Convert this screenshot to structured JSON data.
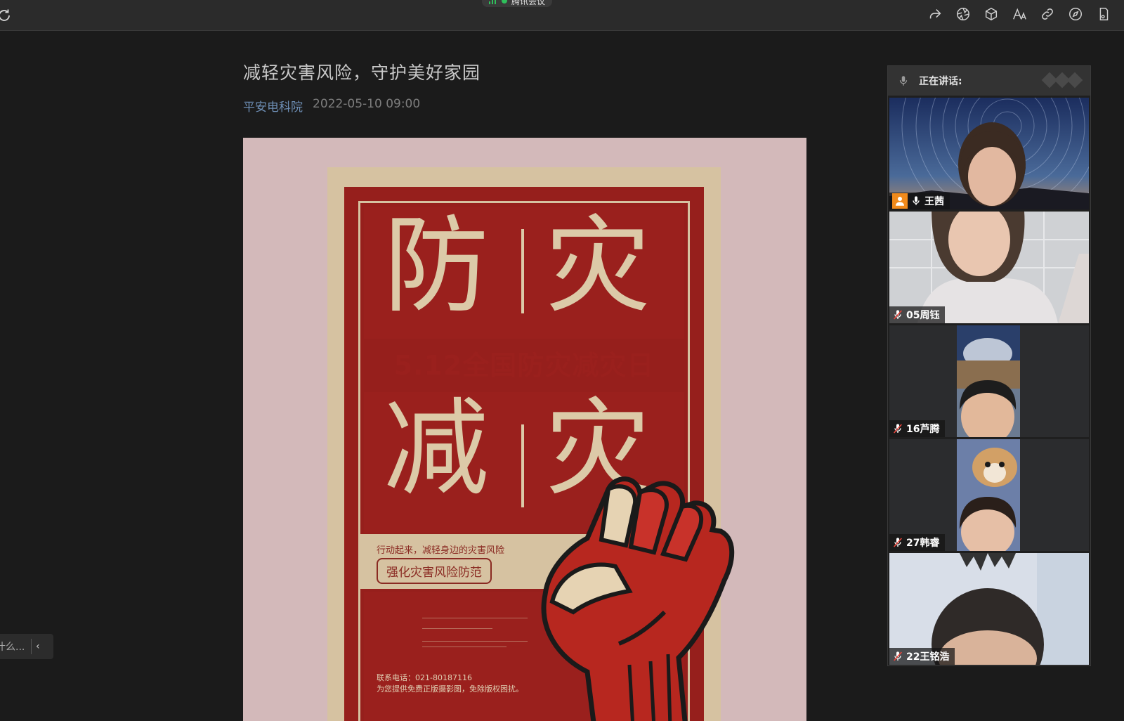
{
  "app": {
    "meeting_name": "腾讯会议",
    "accent": "#2fbf5b",
    "toolbar": [
      "share-icon",
      "aperture-icon",
      "cube-icon",
      "text-size-icon",
      "link-icon",
      "compass-icon",
      "phone-icon"
    ]
  },
  "article": {
    "title": "减轻灾害风险，守护美好家园",
    "author": "平安电科院",
    "date": "2022-05-10 09:00"
  },
  "poster": {
    "char_1": "防",
    "char_2": "灾",
    "char_3": "减",
    "char_4": "灾",
    "date_band": "5.12全国防灾减灾日",
    "slogan": "行动起来，减轻身边的灾害风险",
    "slogan_box": "强化灾害风险防范",
    "contact": "联系电话：021-80187116",
    "notice": "为您提供免费正版摄影图，免除版权困扰。"
  },
  "sidebar_toggle": {
    "text": "什么...",
    "chevron": "‹"
  },
  "video_panel": {
    "speaking_label": "正在讲话:",
    "participants": [
      {
        "name": "王茜",
        "host": true,
        "muted": false
      },
      {
        "name": "05周钰",
        "host": false,
        "muted": true
      },
      {
        "name": "16芦腾",
        "host": false,
        "muted": true
      },
      {
        "name": "27韩睿",
        "host": false,
        "muted": true
      },
      {
        "name": "22王铭浩",
        "host": false,
        "muted": true
      }
    ]
  }
}
